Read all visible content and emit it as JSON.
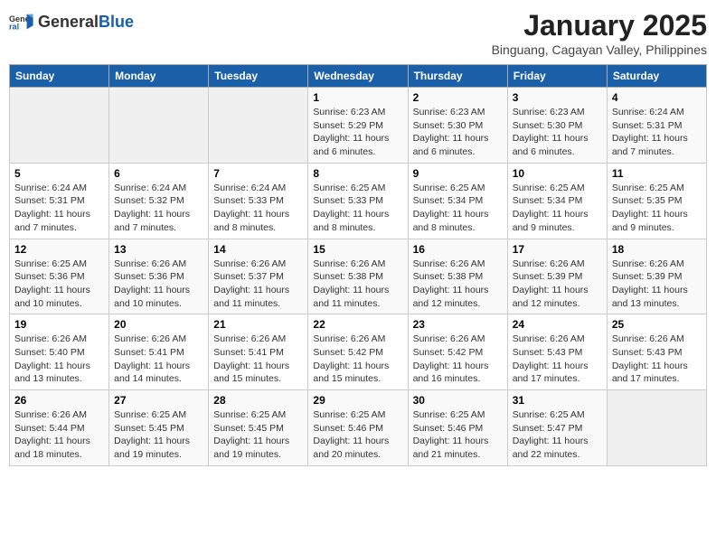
{
  "header": {
    "logo_general": "General",
    "logo_blue": "Blue",
    "month_year": "January 2025",
    "location": "Binguang, Cagayan Valley, Philippines"
  },
  "weekdays": [
    "Sunday",
    "Monday",
    "Tuesday",
    "Wednesday",
    "Thursday",
    "Friday",
    "Saturday"
  ],
  "weeks": [
    [
      {
        "day": "",
        "sunrise": "",
        "sunset": "",
        "daylight": ""
      },
      {
        "day": "",
        "sunrise": "",
        "sunset": "",
        "daylight": ""
      },
      {
        "day": "",
        "sunrise": "",
        "sunset": "",
        "daylight": ""
      },
      {
        "day": "1",
        "sunrise": "Sunrise: 6:23 AM",
        "sunset": "Sunset: 5:29 PM",
        "daylight": "Daylight: 11 hours and 6 minutes."
      },
      {
        "day": "2",
        "sunrise": "Sunrise: 6:23 AM",
        "sunset": "Sunset: 5:30 PM",
        "daylight": "Daylight: 11 hours and 6 minutes."
      },
      {
        "day": "3",
        "sunrise": "Sunrise: 6:23 AM",
        "sunset": "Sunset: 5:30 PM",
        "daylight": "Daylight: 11 hours and 6 minutes."
      },
      {
        "day": "4",
        "sunrise": "Sunrise: 6:24 AM",
        "sunset": "Sunset: 5:31 PM",
        "daylight": "Daylight: 11 hours and 7 minutes."
      }
    ],
    [
      {
        "day": "5",
        "sunrise": "Sunrise: 6:24 AM",
        "sunset": "Sunset: 5:31 PM",
        "daylight": "Daylight: 11 hours and 7 minutes."
      },
      {
        "day": "6",
        "sunrise": "Sunrise: 6:24 AM",
        "sunset": "Sunset: 5:32 PM",
        "daylight": "Daylight: 11 hours and 7 minutes."
      },
      {
        "day": "7",
        "sunrise": "Sunrise: 6:24 AM",
        "sunset": "Sunset: 5:33 PM",
        "daylight": "Daylight: 11 hours and 8 minutes."
      },
      {
        "day": "8",
        "sunrise": "Sunrise: 6:25 AM",
        "sunset": "Sunset: 5:33 PM",
        "daylight": "Daylight: 11 hours and 8 minutes."
      },
      {
        "day": "9",
        "sunrise": "Sunrise: 6:25 AM",
        "sunset": "Sunset: 5:34 PM",
        "daylight": "Daylight: 11 hours and 8 minutes."
      },
      {
        "day": "10",
        "sunrise": "Sunrise: 6:25 AM",
        "sunset": "Sunset: 5:34 PM",
        "daylight": "Daylight: 11 hours and 9 minutes."
      },
      {
        "day": "11",
        "sunrise": "Sunrise: 6:25 AM",
        "sunset": "Sunset: 5:35 PM",
        "daylight": "Daylight: 11 hours and 9 minutes."
      }
    ],
    [
      {
        "day": "12",
        "sunrise": "Sunrise: 6:25 AM",
        "sunset": "Sunset: 5:36 PM",
        "daylight": "Daylight: 11 hours and 10 minutes."
      },
      {
        "day": "13",
        "sunrise": "Sunrise: 6:26 AM",
        "sunset": "Sunset: 5:36 PM",
        "daylight": "Daylight: 11 hours and 10 minutes."
      },
      {
        "day": "14",
        "sunrise": "Sunrise: 6:26 AM",
        "sunset": "Sunset: 5:37 PM",
        "daylight": "Daylight: 11 hours and 11 minutes."
      },
      {
        "day": "15",
        "sunrise": "Sunrise: 6:26 AM",
        "sunset": "Sunset: 5:38 PM",
        "daylight": "Daylight: 11 hours and 11 minutes."
      },
      {
        "day": "16",
        "sunrise": "Sunrise: 6:26 AM",
        "sunset": "Sunset: 5:38 PM",
        "daylight": "Daylight: 11 hours and 12 minutes."
      },
      {
        "day": "17",
        "sunrise": "Sunrise: 6:26 AM",
        "sunset": "Sunset: 5:39 PM",
        "daylight": "Daylight: 11 hours and 12 minutes."
      },
      {
        "day": "18",
        "sunrise": "Sunrise: 6:26 AM",
        "sunset": "Sunset: 5:39 PM",
        "daylight": "Daylight: 11 hours and 13 minutes."
      }
    ],
    [
      {
        "day": "19",
        "sunrise": "Sunrise: 6:26 AM",
        "sunset": "Sunset: 5:40 PM",
        "daylight": "Daylight: 11 hours and 13 minutes."
      },
      {
        "day": "20",
        "sunrise": "Sunrise: 6:26 AM",
        "sunset": "Sunset: 5:41 PM",
        "daylight": "Daylight: 11 hours and 14 minutes."
      },
      {
        "day": "21",
        "sunrise": "Sunrise: 6:26 AM",
        "sunset": "Sunset: 5:41 PM",
        "daylight": "Daylight: 11 hours and 15 minutes."
      },
      {
        "day": "22",
        "sunrise": "Sunrise: 6:26 AM",
        "sunset": "Sunset: 5:42 PM",
        "daylight": "Daylight: 11 hours and 15 minutes."
      },
      {
        "day": "23",
        "sunrise": "Sunrise: 6:26 AM",
        "sunset": "Sunset: 5:42 PM",
        "daylight": "Daylight: 11 hours and 16 minutes."
      },
      {
        "day": "24",
        "sunrise": "Sunrise: 6:26 AM",
        "sunset": "Sunset: 5:43 PM",
        "daylight": "Daylight: 11 hours and 17 minutes."
      },
      {
        "day": "25",
        "sunrise": "Sunrise: 6:26 AM",
        "sunset": "Sunset: 5:43 PM",
        "daylight": "Daylight: 11 hours and 17 minutes."
      }
    ],
    [
      {
        "day": "26",
        "sunrise": "Sunrise: 6:26 AM",
        "sunset": "Sunset: 5:44 PM",
        "daylight": "Daylight: 11 hours and 18 minutes."
      },
      {
        "day": "27",
        "sunrise": "Sunrise: 6:25 AM",
        "sunset": "Sunset: 5:45 PM",
        "daylight": "Daylight: 11 hours and 19 minutes."
      },
      {
        "day": "28",
        "sunrise": "Sunrise: 6:25 AM",
        "sunset": "Sunset: 5:45 PM",
        "daylight": "Daylight: 11 hours and 19 minutes."
      },
      {
        "day": "29",
        "sunrise": "Sunrise: 6:25 AM",
        "sunset": "Sunset: 5:46 PM",
        "daylight": "Daylight: 11 hours and 20 minutes."
      },
      {
        "day": "30",
        "sunrise": "Sunrise: 6:25 AM",
        "sunset": "Sunset: 5:46 PM",
        "daylight": "Daylight: 11 hours and 21 minutes."
      },
      {
        "day": "31",
        "sunrise": "Sunrise: 6:25 AM",
        "sunset": "Sunset: 5:47 PM",
        "daylight": "Daylight: 11 hours and 22 minutes."
      },
      {
        "day": "",
        "sunrise": "",
        "sunset": "",
        "daylight": ""
      }
    ]
  ]
}
